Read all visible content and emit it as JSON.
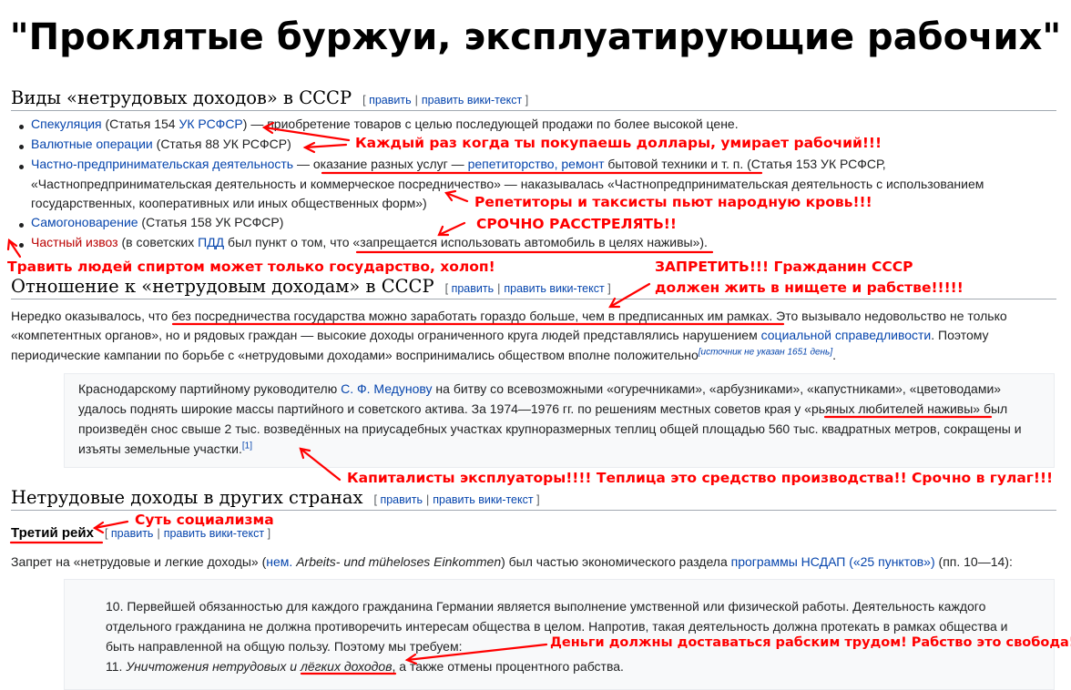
{
  "meme_title": "\"Проклятые буржуи, эксплуатирующие рабочих\"",
  "edit_links": {
    "edit": "править",
    "edit_wiki": "править вики-текст",
    "sep": "|",
    "open": "[",
    "close": "]"
  },
  "section1": {
    "heading": "Виды «нетрудовых доходов» в СССР",
    "items": [
      {
        "link": "Спекуляция",
        "t1": " (Статья 154 ",
        "link2": "УК РСФСР",
        "t2": ") — приобретение товаров с целью последующей продажи по более высокой цене."
      },
      {
        "link": "Валютные операции",
        "t1": " (Статья 88 УК РСФСР)"
      },
      {
        "link": "Частно-предпринимательская деятельность",
        "t1": " — ",
        "t2": "оказание разных услуг — ",
        "link2": "репетиторство, ремонт",
        "t3": " бытовой техники и т. п.",
        "t4": " (Статья 153 УК РСФСР,",
        "line2": "«Частнопредпринимательская деятельность и коммерческое посредничество» — наказывалась «Частнопредпринимательская деятельность с использованием",
        "line3": "государственных, кооперативных или иных общественных форм»)"
      },
      {
        "link": "Самогоноварение",
        "t1": " (Статья 158 УК РСФСР)"
      },
      {
        "link": "Частный извоз",
        "t1": " (в советских ",
        "link2": "ПДД",
        "t2": " был пункт о том, что «",
        "t3": "запрещается использовать автомобиль в целях наживы",
        "t4": "»)."
      }
    ]
  },
  "section2": {
    "heading": "Отношение к «нетрудовым доходам» в СССР",
    "p_l1a": "Нередко оказывалось, что ",
    "p_l1b": "без посредничества государства можно заработать гораздо больше, чем в предписанных им рамках",
    "p_l1c": ". Это вызывало недовольство не только",
    "p_l2a": "«компетентных органов», но и рядовых граждан — высокие доходы ограниченного круга людей представлялись нарушением ",
    "p_l2link": "социальной справедливости",
    "p_l2b": ". Поэтому",
    "p_l3": "периодические кампании по борьбе с «нетрудовыми доходами» воспринимались обществом вполне положительно",
    "p_l3sup": "[источник не указан 1651 день]",
    "p_l3end": ".",
    "quote_l1a": "Краснодарскому партийному руководителю ",
    "quote_l1link": "С. Ф. Медунову",
    "quote_l1b": " на битву со всевозможными «огуречниками», «арбузниками», «капустниками», «цветоводами»",
    "quote_l2": "удалось поднять широкие массы партийного и советского актива. За 1974—1976 гг. по решениям местных советов края у «",
    "quote_l2u": "рьяных любителей наживы",
    "quote_l2b": "» был",
    "quote_l3": "произведён снос свыше 2 тыс. возведённых на приусадебных участках крупноразмерных теплиц общей площадью 560 тыс. квадратных метров, сокращены и",
    "quote_l4": "изъяты земельные участки.",
    "quote_sup": "[1]"
  },
  "section3": {
    "heading": "Нетрудовые доходы в других странах",
    "sub_heading": "Третий рейх",
    "p_a": "Запрет на «нетрудовые и легкие доходы» (",
    "p_link1": "нем.",
    "p_ital": " Arbeits- und müheloses Einkommen",
    "p_b": ") был частью экономического раздела ",
    "p_link2": "программы НСДАП («25 пунктов»)",
    "p_c": " (пп. 10—14):",
    "q_l1": "10. Первейшей обязанностью для каждого гражданина Германии является выполнение умственной или физической работы. Деятельность каждого",
    "q_l2": "отдельного гражданина не должна противоречить интересам общества в целом. Напротив, такая деятельность должна протекать в рамках общества и",
    "q_l3": "быть направленной на общую пользу. Поэтому мы требуем:",
    "q_l4a": "11. ",
    "q_l4i": "Уничтожения нетрудовых и ",
    "q_l4u": "лёгких доходов",
    "q_l4b": ", а также отмены процентного рабства."
  },
  "captions": {
    "c1": "Каждый раз когда ты покупаешь доллары, умирает рабочий!!!",
    "c2": "Репетиторы и таксисты пьют народную кровь!!!",
    "c3": "СРОЧНО РАССТРЕЛЯТЬ!!",
    "c4": "Травить людей спиртом может только государство, холоп!",
    "c5a": "ЗАПРЕТИТЬ!!! Гражданин СССР",
    "c5b": "должен жить в нищете и рабстве!!!!!",
    "c6": "Капиталисты эксплуаторы!!!! Теплица это средство производства!! Срочно в гулаг!!!",
    "c7": "Суть социализма",
    "c8": "Деньги должны доставаться рабским трудом! Рабство это свобода!"
  },
  "colors": {
    "link": "#0645ad",
    "redlink": "#ba0000",
    "annotation": "#ff0000",
    "quote_bg": "#f8f9fa"
  }
}
